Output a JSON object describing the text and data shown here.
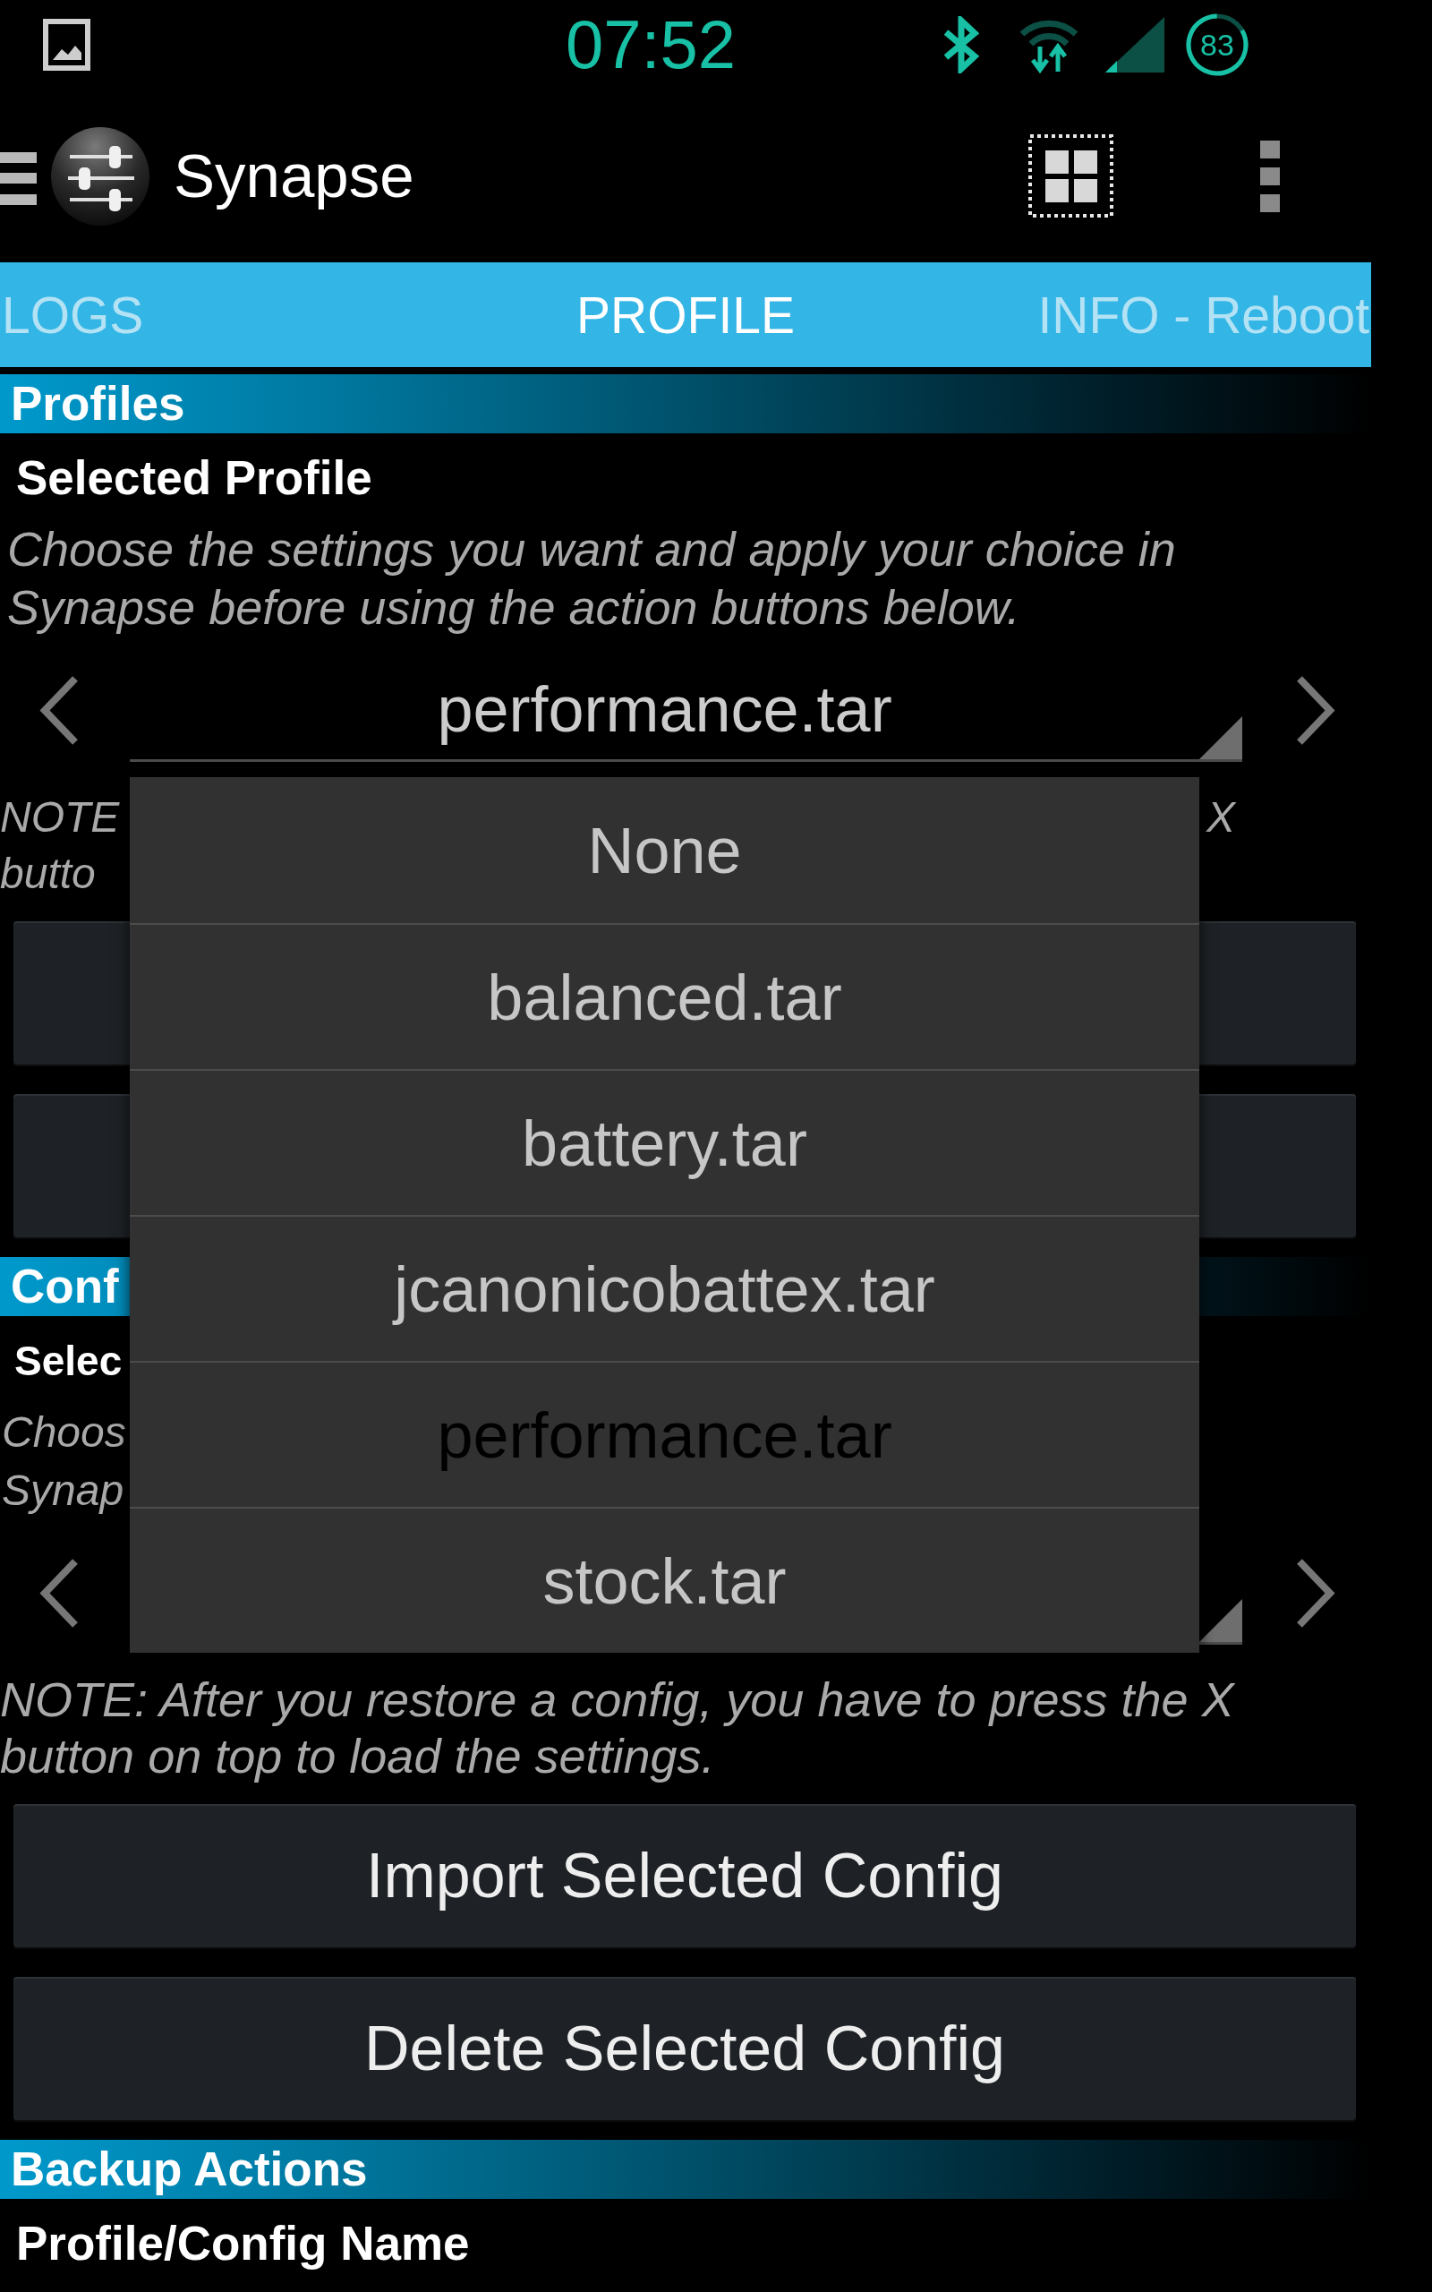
{
  "status_bar": {
    "time": "07:52",
    "battery": "83"
  },
  "action_bar": {
    "title": "Synapse"
  },
  "tabs": [
    {
      "label": "LOGS",
      "selected": false
    },
    {
      "label": "PROFILE",
      "selected": true
    },
    {
      "label": "INFO - Reboot",
      "selected": false
    }
  ],
  "sections": [
    {
      "header": "Profiles",
      "label": "Selected Profile",
      "description": "Choose the settings you want and apply your choice in Synapse before using the action buttons below.",
      "spinner": {
        "kind": "labelled",
        "value": "performance.tar"
      },
      "note_fragments": {
        "line_1_left": "NOTE",
        "line_1_right": "X",
        "line_2_left": "butto"
      },
      "buttons": [
        {
          "kind": "covered"
        },
        {
          "kind": "covered"
        }
      ]
    },
    {
      "header": "Conf",
      "label_fragment": "Selec",
      "description_fragments": [
        "Choos",
        "Synap"
      ],
      "spinner": {
        "kind": "covered"
      },
      "note": "NOTE: After you restore a config, you have to press the X button on top to load the settings.",
      "buttons": [
        {
          "kind": "labelled",
          "label": "Import Selected Config"
        },
        {
          "kind": "labelled",
          "label": "Delete Selected Config"
        }
      ]
    },
    {
      "header": "Backup Actions",
      "label": "Profile/Config Name"
    }
  ],
  "dropdown": {
    "options": [
      {
        "label": "None",
        "selected": false
      },
      {
        "label": "balanced.tar",
        "selected": false
      },
      {
        "label": "battery.tar",
        "selected": false
      },
      {
        "label": "jcanonicobattex.tar",
        "selected": false
      },
      {
        "label": "performance.tar",
        "selected": true
      },
      {
        "label": "stock.tar",
        "selected": false
      }
    ]
  }
}
